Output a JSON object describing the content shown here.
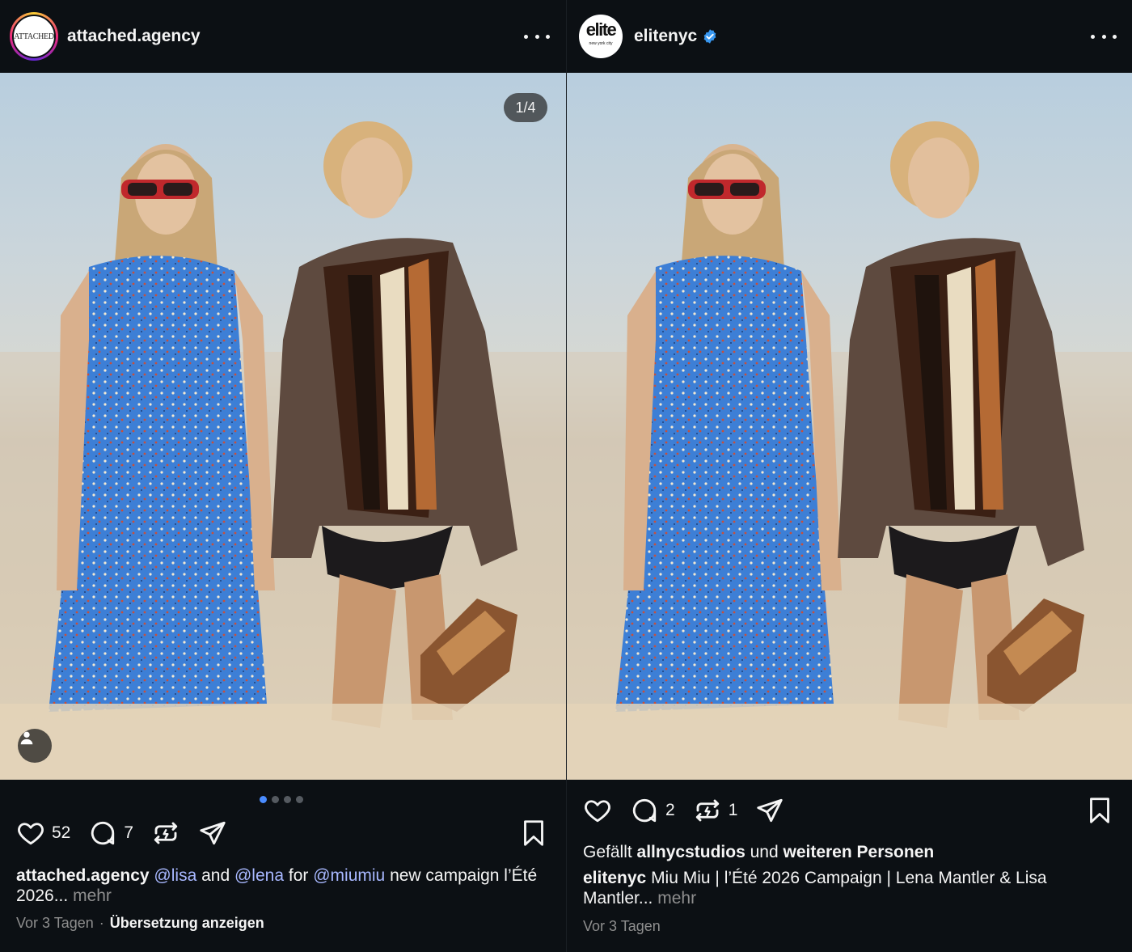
{
  "posts": [
    {
      "username": "attached.agency",
      "avatar_text": "ATTACHED",
      "image_counter": "1/4",
      "likes_count": "52",
      "comments_count": "7",
      "caption": {
        "user": "attached.agency",
        "mention1": "@lisa",
        "and": "and",
        "mention2": "@lena",
        "for": "for",
        "mention3": "@miumiu",
        "text": "new campaign l’Été 2026...",
        "more": "mehr"
      },
      "time": "Vor 3 Tagen",
      "separator": "·",
      "translate": "Übersetzung anzeigen"
    },
    {
      "username": "elitenyc",
      "avatar_text": "elite",
      "avatar_subtext": "new york city",
      "comments_count": "2",
      "reposts_count": "1",
      "liked_by": {
        "prefix": "Gefällt",
        "user": "allnycstudios",
        "middle": "und",
        "others": "weiteren Personen"
      },
      "caption": {
        "user": "elitenyc",
        "text": "Miu Miu | l’Été 2026 Campaign | Lena Mantler & Lisa Mantler...",
        "more": "mehr"
      },
      "time": "Vor 3 Tagen"
    }
  ]
}
